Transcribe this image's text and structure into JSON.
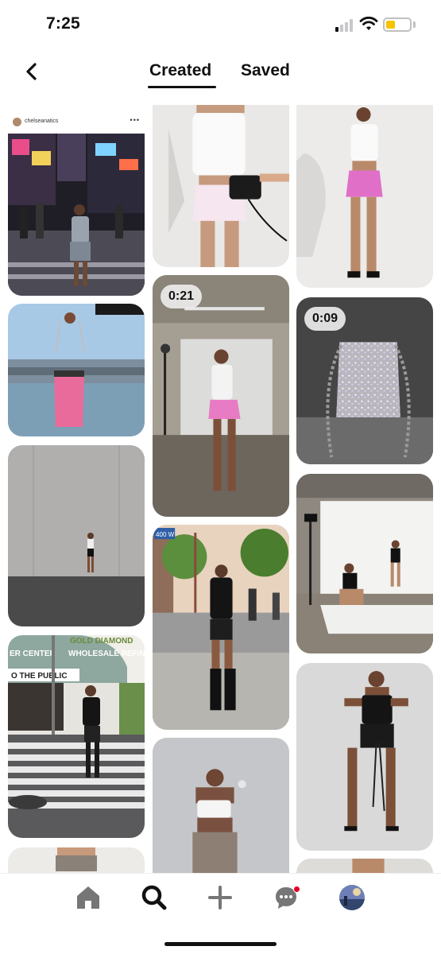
{
  "status_bar": {
    "time": "7:25",
    "battery_color": "#f5c400",
    "icons": [
      "cellular-signal-icon",
      "wifi-icon",
      "battery-icon"
    ]
  },
  "header": {
    "back_icon": "chevron-left-icon",
    "tabs": [
      {
        "label": "Created",
        "active": true
      },
      {
        "label": "Saved",
        "active": false
      }
    ]
  },
  "feed": {
    "pins": [
      {
        "column": 1,
        "subject": "street-style-photo",
        "instagram_user": "chelseanatics",
        "more": "•••"
      },
      {
        "column": 1,
        "subject": "pink-bag-photo"
      },
      {
        "column": 1,
        "subject": "concrete-wall-photo"
      },
      {
        "column": 1,
        "subject": "crosswalk-photo",
        "sign_texts": [
          "GOLD DIAMOND",
          "ER CENTER",
          "WHOLESALE REFINE",
          "O THE PUBLIC"
        ]
      },
      {
        "column": 1,
        "subject": "cropped-photo"
      },
      {
        "column": 2,
        "subject": "white-top-pink-skirt-photo"
      },
      {
        "column": 2,
        "subject": "studio-video",
        "duration": "0:21"
      },
      {
        "column": 2,
        "subject": "city-sidewalk-photo",
        "sign_text": "400 W"
      },
      {
        "column": 2,
        "subject": "flash-portrait-photo"
      },
      {
        "column": 3,
        "subject": "studio-pose-photo"
      },
      {
        "column": 3,
        "subject": "sparkle-bag-video",
        "duration": "0:09"
      },
      {
        "column": 3,
        "subject": "studio-shoot-photo"
      },
      {
        "column": 3,
        "subject": "black-outfit-photo"
      },
      {
        "column": 3,
        "subject": "cropped-photo-2"
      }
    ]
  },
  "bottom_nav": {
    "items": [
      "home-icon",
      "search-icon",
      "plus-icon",
      "message-icon",
      "profile-avatar"
    ],
    "active": "search-icon",
    "notification_color": "#e60023"
  }
}
